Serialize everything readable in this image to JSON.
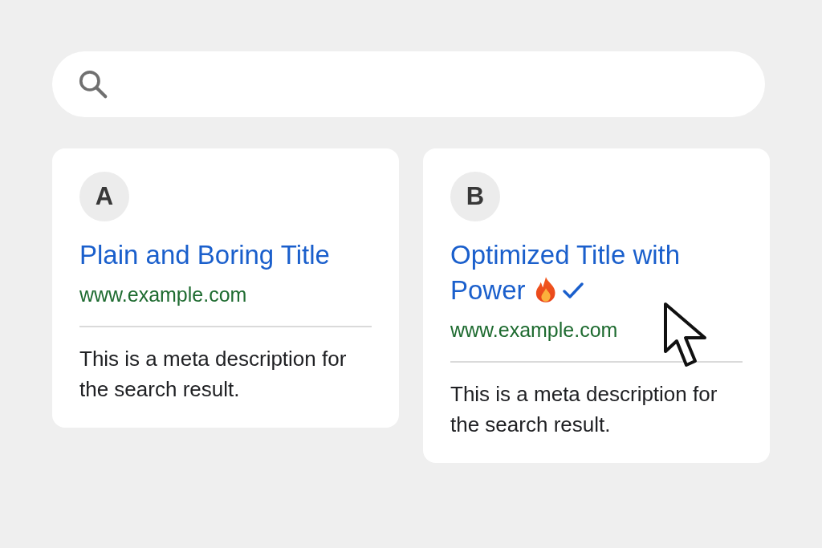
{
  "results": [
    {
      "label": "A",
      "kind": "plain",
      "title": "Plain and Boring Title",
      "url": "www.example.com",
      "description": "This is a meta description for the search result."
    },
    {
      "label": "B",
      "kind": "optimized",
      "title": "Optimized Title with Power",
      "url": "www.example.com",
      "description": "This is a meta description for the search result."
    }
  ]
}
